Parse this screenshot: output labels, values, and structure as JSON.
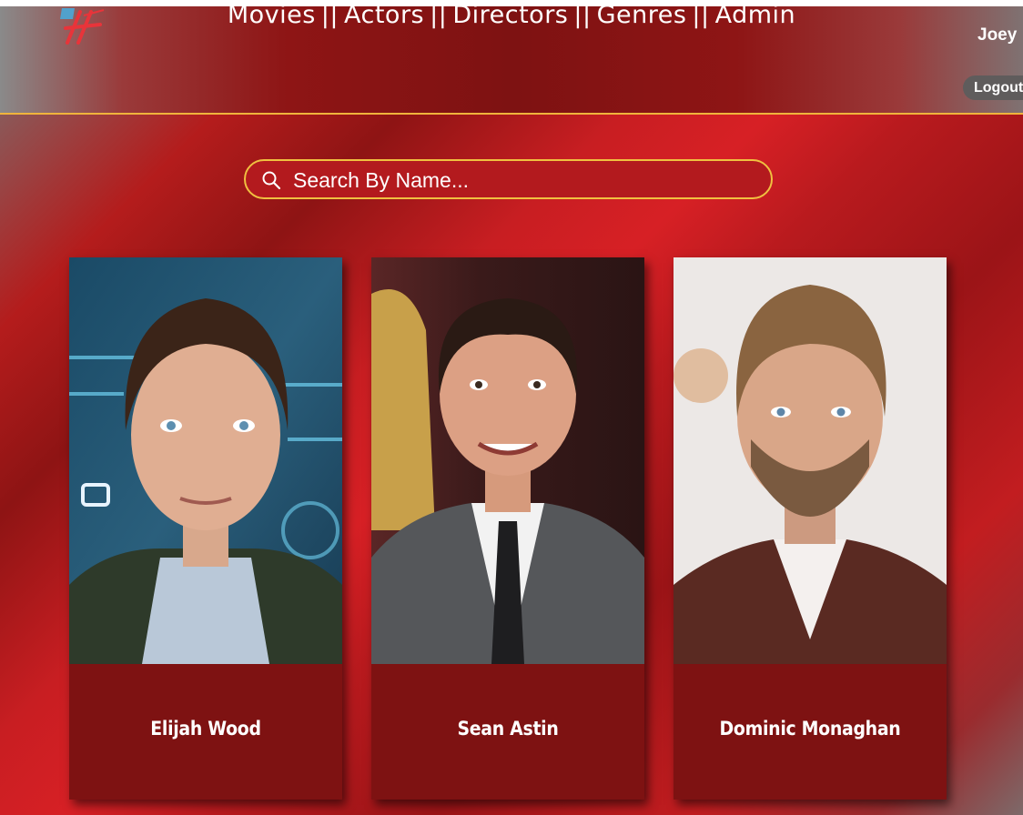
{
  "nav": {
    "items": [
      "Movies",
      "Actors",
      "Directors",
      "Genres",
      "Admin"
    ],
    "separator": "||"
  },
  "user": {
    "name": "Joey",
    "logout_label": "Logout"
  },
  "search": {
    "placeholder": "Search By Name..."
  },
  "actors": [
    {
      "name": "Elijah Wood"
    },
    {
      "name": "Sean Astin"
    },
    {
      "name": "Dominic Monaghan"
    }
  ],
  "colors": {
    "accent": "#f0c040",
    "card": "#7e1212",
    "header": "#7e1212"
  }
}
